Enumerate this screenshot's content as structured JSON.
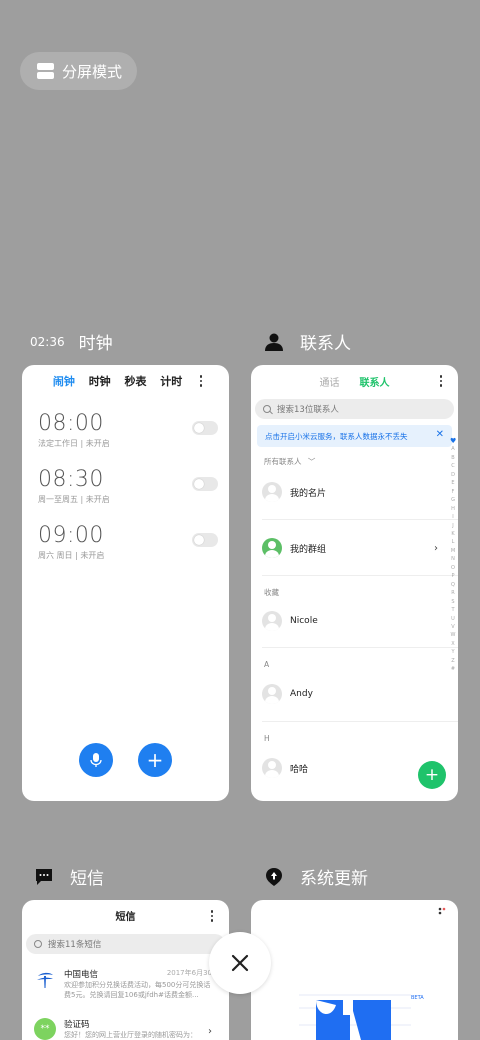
{
  "split_screen": {
    "label": "分屏模式"
  },
  "clock_app": {
    "badge_time": "02:36",
    "title": "时钟",
    "tabs": [
      "闹钟",
      "时钟",
      "秒表",
      "计时"
    ],
    "alarms": [
      {
        "time": "08:00",
        "sub": "法定工作日 | 未开启"
      },
      {
        "time": "08:30",
        "sub": "周一至周五 | 未开启"
      },
      {
        "time": "09:00",
        "sub": "周六 周日 | 未开启"
      }
    ],
    "accent": "#1f8cf0"
  },
  "contacts_app": {
    "title": "联系人",
    "tabs": [
      "通话",
      "联系人"
    ],
    "search_placeholder": "搜索13位联系人",
    "banner": "点击开启小米云服务，联系人数据永不丢失",
    "all_contacts": "所有联系人",
    "my_card": "我的名片",
    "my_groups": "我的群组",
    "sections": [
      {
        "header": "收藏",
        "name": "Nicole"
      },
      {
        "header": "A",
        "name": "Andy"
      },
      {
        "header": "H",
        "name": "哈哈"
      }
    ],
    "alphabet": [
      "A",
      "B",
      "C",
      "D",
      "E",
      "F",
      "G",
      "H",
      "I",
      "J",
      "K",
      "L",
      "M",
      "N",
      "O",
      "P",
      "Q",
      "R",
      "S",
      "T",
      "U",
      "V",
      "W",
      "X",
      "Y",
      "Z",
      "#"
    ],
    "accent": "#1fc36b"
  },
  "sms_app": {
    "title": "短信",
    "header": "短信",
    "search_placeholder": "搜索11条短信",
    "messages": [
      {
        "name": "中国电信",
        "date": "2017年6月30",
        "preview": "欢迎参加积分兑换话费活动，每500分可兑换话费5元。兑换请回复106或jfdh#话费金额..."
      },
      {
        "name": "验证码",
        "date": "",
        "preview": "您好！您的网上营业厅登录的随机密码为："
      }
    ]
  },
  "update_app": {
    "title": "系统更新",
    "beta_label": "BETA"
  }
}
